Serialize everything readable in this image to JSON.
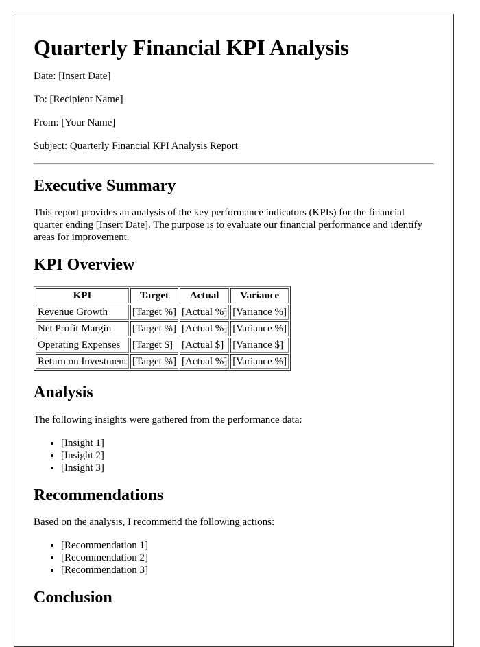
{
  "document": {
    "title": "Quarterly Financial KPI Analysis",
    "meta": {
      "date": "Date: [Insert Date]",
      "to": "To: [Recipient Name]",
      "from": "From: [Your Name]",
      "subject": "Subject: Quarterly Financial KPI Analysis Report"
    },
    "executive_summary": {
      "heading": "Executive Summary",
      "body": "This report provides an analysis of the key performance indicators (KPIs) for the financial quarter ending [Insert Date]. The purpose is to evaluate our financial performance and identify areas for improvement."
    },
    "kpi_overview": {
      "heading": "KPI Overview",
      "columns": [
        "KPI",
        "Target",
        "Actual",
        "Variance"
      ],
      "rows": [
        [
          "Revenue Growth",
          "[Target %]",
          "[Actual %]",
          "[Variance %]"
        ],
        [
          "Net Profit Margin",
          "[Target %]",
          "[Actual %]",
          "[Variance %]"
        ],
        [
          "Operating Expenses",
          "[Target $]",
          "[Actual $]",
          "[Variance $]"
        ],
        [
          "Return on Investment",
          "[Target %]",
          "[Actual %]",
          "[Variance %]"
        ]
      ]
    },
    "analysis": {
      "heading": "Analysis",
      "intro": "The following insights were gathered from the performance data:",
      "items": [
        "[Insight 1]",
        "[Insight 2]",
        "[Insight 3]"
      ]
    },
    "recommendations": {
      "heading": "Recommendations",
      "intro": "Based on the analysis, I recommend the following actions:",
      "items": [
        "[Recommendation 1]",
        "[Recommendation 2]",
        "[Recommendation 3]"
      ]
    },
    "conclusion": {
      "heading": "Conclusion"
    }
  }
}
